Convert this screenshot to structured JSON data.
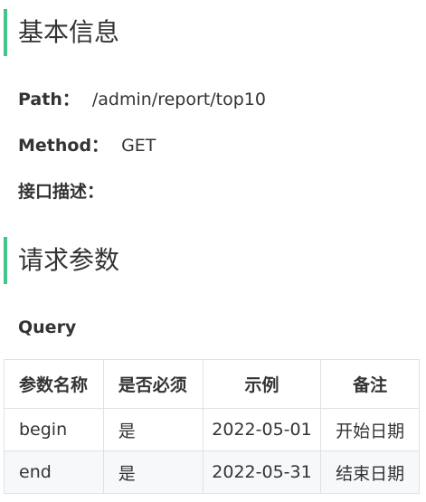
{
  "sections": {
    "basic": {
      "title": "基本信息",
      "path_label": "Path：",
      "path_value": "/admin/report/top10",
      "method_label": "Method：",
      "method_value": "GET",
      "description_label": "接口描述："
    },
    "request": {
      "title": "请求参数",
      "query_title": "Query"
    }
  },
  "table": {
    "headers": [
      "参数名称",
      "是否必须",
      "示例",
      "备注"
    ],
    "rows": [
      [
        "begin",
        "是",
        "2022-05-01",
        "开始日期"
      ],
      [
        "end",
        "是",
        "2022-05-31",
        "结束日期"
      ]
    ]
  },
  "colors": {
    "accent": "#42c48a",
    "border": "#dfe2e5",
    "text": "#333333"
  }
}
